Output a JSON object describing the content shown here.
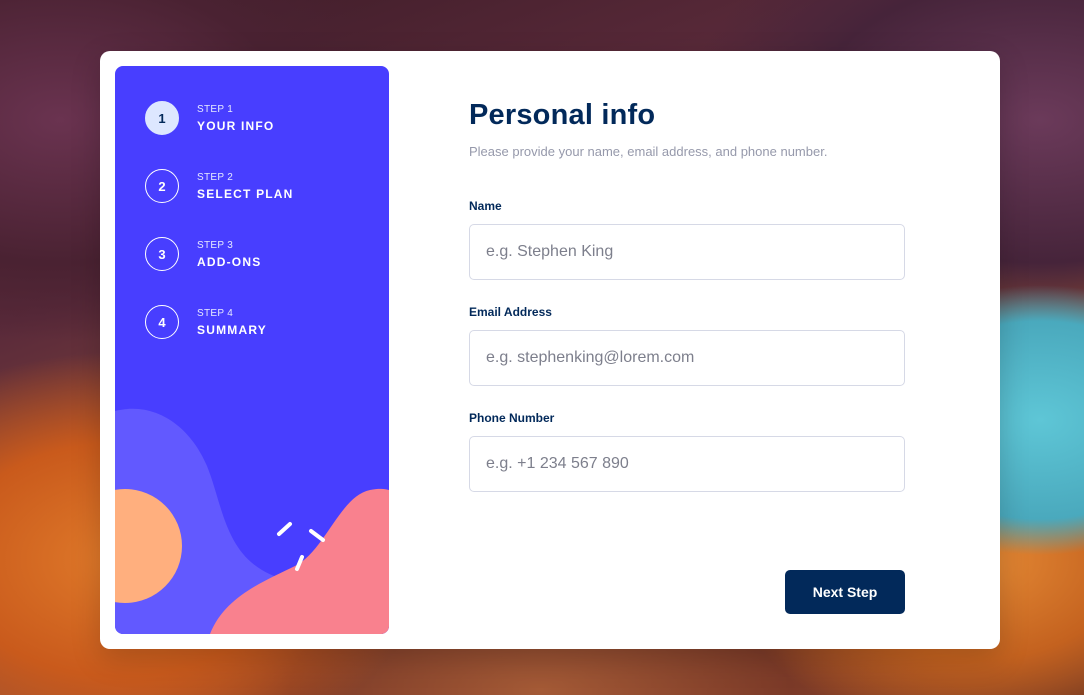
{
  "colors": {
    "sidebar_bg": "#483eff",
    "accent_dark": "#02295a",
    "active_step_bg": "#dde7ff",
    "muted_text": "#9699ab",
    "border": "#d6d9e6",
    "blob_orange": "#ffaf7e",
    "blob_pink": "#f9818e",
    "blob_light": "#6259ff"
  },
  "steps": [
    {
      "number": "1",
      "label": "STEP 1",
      "title": "YOUR INFO",
      "active": true
    },
    {
      "number": "2",
      "label": "STEP 2",
      "title": "SELECT PLAN",
      "active": false
    },
    {
      "number": "3",
      "label": "STEP 3",
      "title": "ADD-ONS",
      "active": false
    },
    {
      "number": "4",
      "label": "STEP 4",
      "title": "SUMMARY",
      "active": false
    }
  ],
  "form": {
    "title": "Personal info",
    "subtitle": "Please provide your name, email address, and phone number.",
    "fields": [
      {
        "label": "Name",
        "value": "",
        "placeholder": "e.g. Stephen King"
      },
      {
        "label": "Email Address",
        "value": "",
        "placeholder": "e.g. stephenking@lorem.com"
      },
      {
        "label": "Phone Number",
        "value": "",
        "placeholder": "e.g. +1 234 567 890"
      }
    ],
    "next_label": "Next Step"
  }
}
